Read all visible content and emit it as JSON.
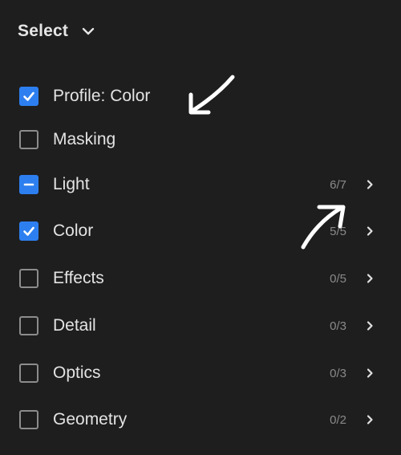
{
  "header": {
    "label": "Select",
    "icon": "chevron-down-icon"
  },
  "items": [
    {
      "label": "Profile: Color",
      "state": "checked",
      "count": "",
      "has_chevron": false
    },
    {
      "label": "Masking",
      "state": "unchecked",
      "count": "",
      "has_chevron": false
    },
    {
      "label": "Light",
      "state": "mixed",
      "count": "6/7",
      "has_chevron": true
    },
    {
      "label": "Color",
      "state": "checked",
      "count": "5/5",
      "has_chevron": true
    },
    {
      "label": "Effects",
      "state": "unchecked",
      "count": "0/5",
      "has_chevron": true
    },
    {
      "label": "Detail",
      "state": "unchecked",
      "count": "0/3",
      "has_chevron": true
    },
    {
      "label": "Optics",
      "state": "unchecked",
      "count": "0/3",
      "has_chevron": true
    },
    {
      "label": "Geometry",
      "state": "unchecked",
      "count": "0/2",
      "has_chevron": true
    }
  ],
  "colors": {
    "background": "#1e1e1e",
    "accent": "#2d7ff0",
    "text": "#e3e3e3",
    "muted": "#8a8a8a"
  }
}
